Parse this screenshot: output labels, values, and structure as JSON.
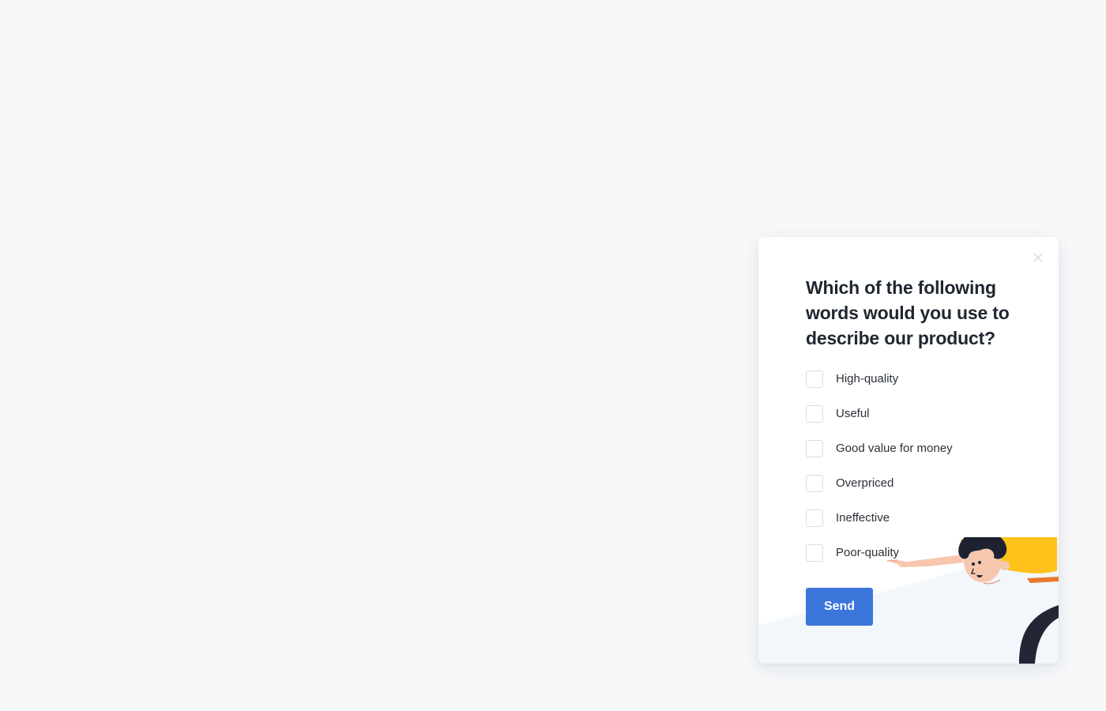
{
  "survey": {
    "question": "Which of the following words would you use to describe our product?",
    "options": [
      {
        "label": "High-quality",
        "checked": false
      },
      {
        "label": "Useful",
        "checked": false
      },
      {
        "label": "Good value for money",
        "checked": false
      },
      {
        "label": "Overpriced",
        "checked": false
      },
      {
        "label": "Ineffective",
        "checked": false
      },
      {
        "label": "Poor-quality",
        "checked": false
      }
    ],
    "send_label": "Send",
    "close_icon": "close-icon"
  },
  "colors": {
    "page_background": "#f6f8fa",
    "card_background": "#ffffff",
    "accent": "#3b76db",
    "heading": "#1f262f",
    "illustration_shirt": "#ffc21a",
    "illustration_hair": "#1e2230"
  }
}
